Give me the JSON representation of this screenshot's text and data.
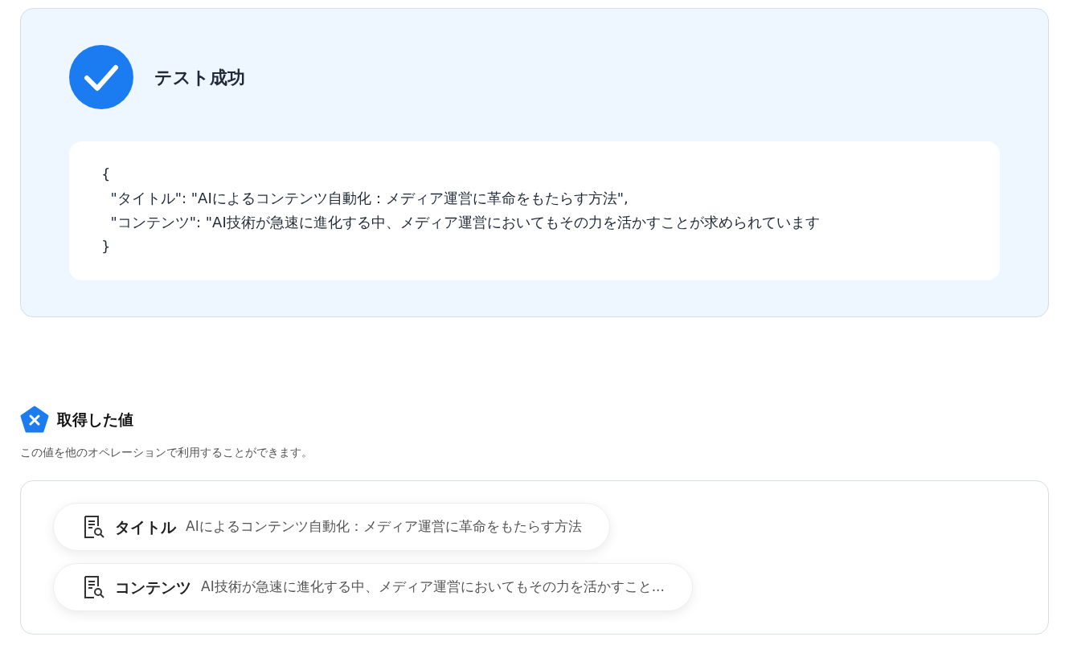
{
  "result": {
    "success": true,
    "title": "テスト成功",
    "code_lines": [
      "{",
      "  \"タイトル\": \"AIによるコンテンツ自動化：メディア運営に革命をもたらす方法\",",
      "  \"コンテンツ\": \"AI技術が急速に進化する中、メディア運営においてもその力を活かすことが求められています",
      "}"
    ]
  },
  "values": {
    "title": "取得した値",
    "description": "この値を他のオペレーションで利用することができます。",
    "items": [
      {
        "name": "タイトル",
        "value": "AIによるコンテンツ自動化：メディア運営に革命をもたらす方法"
      },
      {
        "name": "コンテンツ",
        "value": "AI技術が急速に進化する中、メディア運営においてもその力を活かすこと..."
      }
    ]
  }
}
